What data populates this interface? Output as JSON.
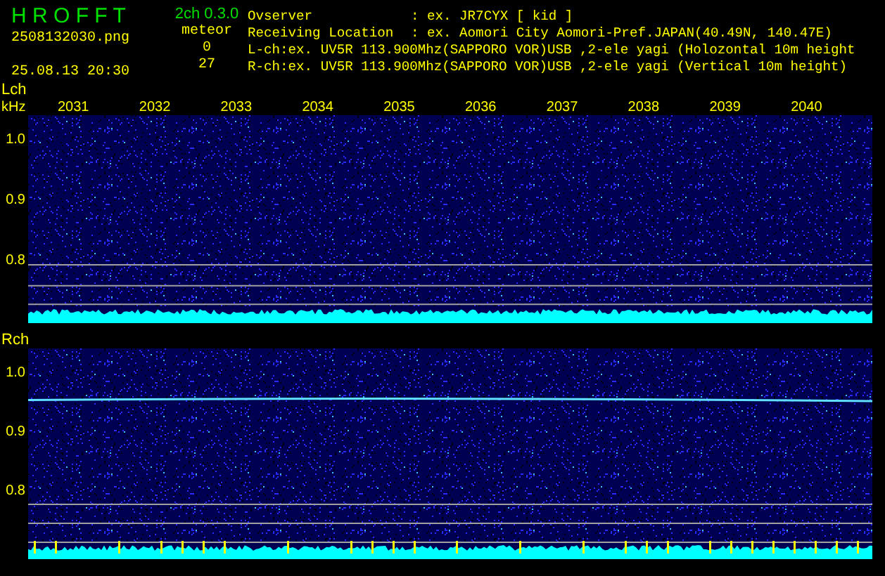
{
  "header": {
    "app_title": "H R O F F T",
    "version": "2ch 0.3.0",
    "filename": "2508132030.png",
    "datetime": "25.08.13 20:30",
    "meteor_label": "meteor",
    "counts": [
      "0",
      "27"
    ],
    "info_lines": [
      {
        "kind": "labeled",
        "label": "Ovserver",
        "value": ": ex. JR7CYX [ kid ]"
      },
      {
        "kind": "labeled",
        "label": "Receiving Location",
        "value": ": ex. Aomori City Aomori-Pref.JAPAN(40.49N, 140.47E)"
      },
      {
        "kind": "plain",
        "text": "L-ch:ex. UV5R 113.900Mhz(SAPPORO VOR)USB ,2-ele yagi (Holozontal 10m height"
      },
      {
        "kind": "plain",
        "text": "R-ch:ex. UV5R 113.900Mhz(SAPPORO VOR)USB ,2-ele yagi (Vertical 10m height)"
      }
    ]
  },
  "channels": [
    {
      "label": "Lch",
      "unit": "kHz",
      "time_labels": [
        "2031",
        "2032",
        "2033",
        "2034",
        "2035",
        "2036",
        "2037",
        "2038",
        "2039",
        "2040"
      ],
      "y_labels": [
        "1.0",
        "0.9",
        "0.8"
      ],
      "trace": false,
      "meteors": false
    },
    {
      "label": "Rch",
      "y_labels": [
        "1.0",
        "0.9",
        "0.8"
      ],
      "trace": true,
      "meteors": true
    }
  ]
}
